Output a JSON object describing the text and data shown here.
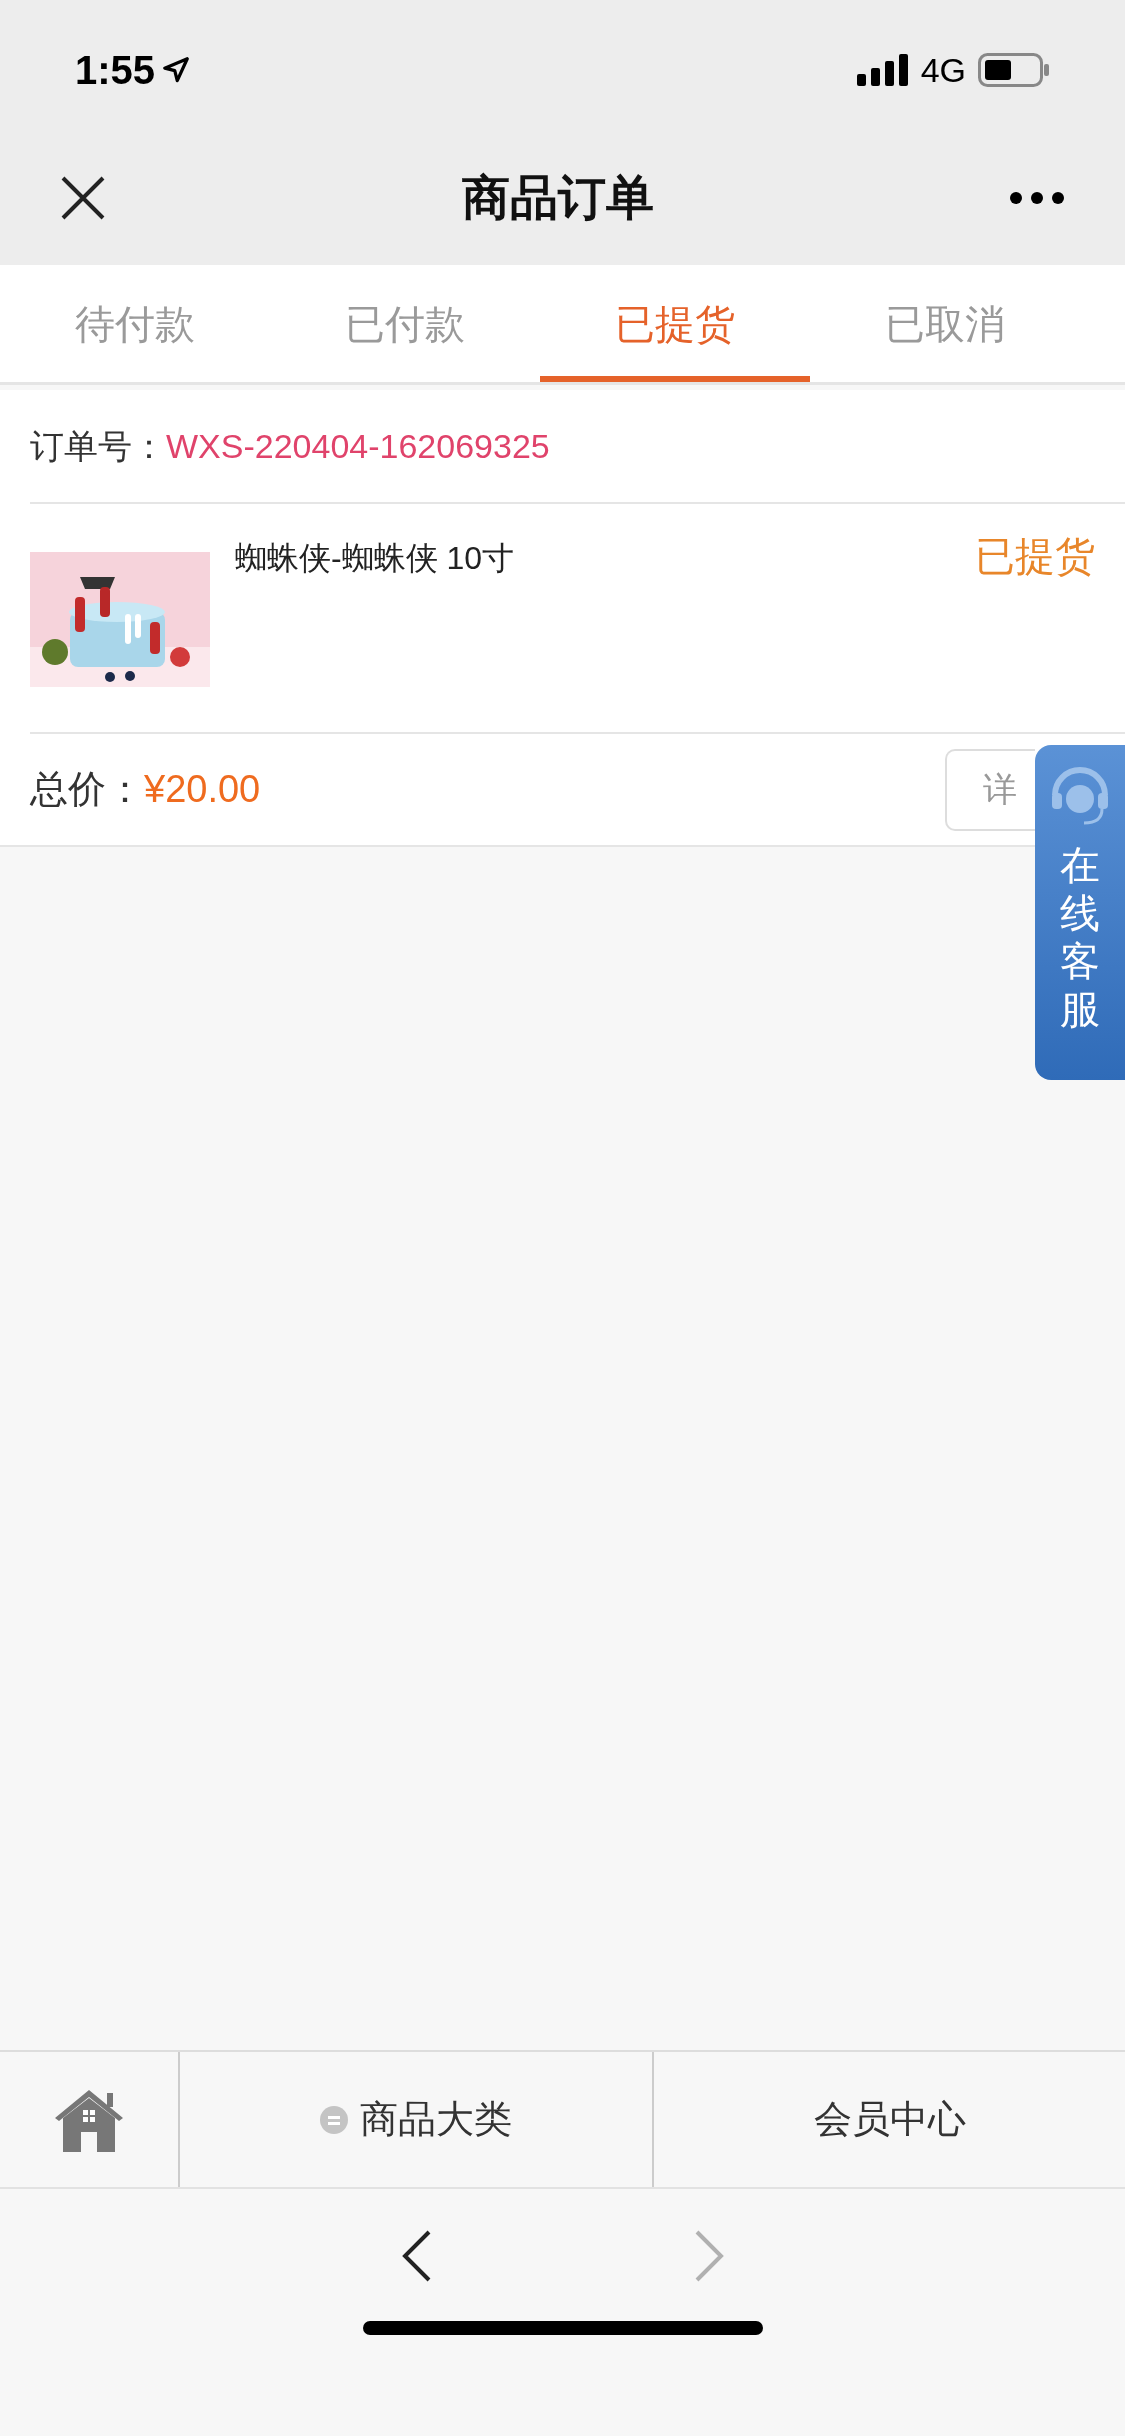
{
  "status_bar": {
    "time": "1:55",
    "network": "4G"
  },
  "nav": {
    "title": "商品订单"
  },
  "tabs": [
    {
      "label": "待付款",
      "selected": false
    },
    {
      "label": "已付款",
      "selected": false
    },
    {
      "label": "已提货",
      "selected": true
    },
    {
      "label": "已取消",
      "selected": false
    }
  ],
  "order": {
    "number_label": "订单号：",
    "number": "WXS-220404-162069325",
    "items": [
      {
        "name": "蜘蛛侠-蜘蛛侠 10寸",
        "status": "已提货"
      }
    ],
    "total_label": "总价：",
    "total": "¥20.00",
    "detail_button": "详"
  },
  "service_tab": {
    "label": "在线客服"
  },
  "bottom_nav": {
    "categories": "商品大类",
    "member": "会员中心"
  },
  "browser_toolbar": {
    "back_enabled": true,
    "forward_enabled": false
  }
}
